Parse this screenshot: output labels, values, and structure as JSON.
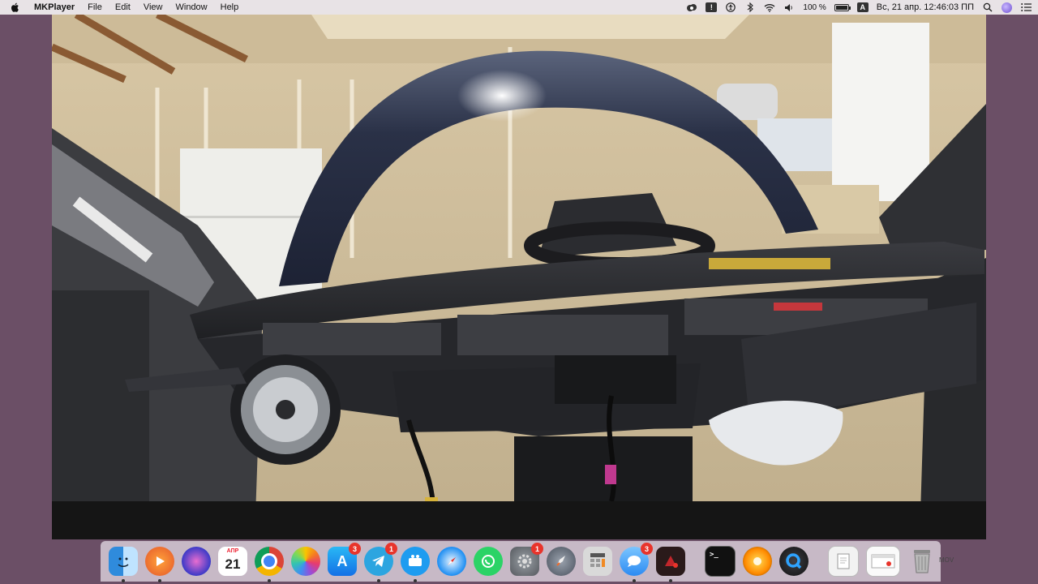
{
  "menubar": {
    "app_name": "MKPlayer",
    "menus": [
      "File",
      "Edit",
      "View",
      "Window",
      "Help"
    ],
    "battery_text": "100 %",
    "battery_level": 1.0,
    "input_source": "A",
    "datetime": "Вс, 21 апр.  12:46:03 ПП"
  },
  "dock": {
    "calendar_month": "АПР",
    "calendar_day": "21",
    "terminal_prompt": ">_",
    "badges": {
      "app_store": "3",
      "telegram": "1",
      "system_prefs": "1",
      "messages": "3"
    },
    "mov_label": "MOV"
  },
  "colors": {
    "menubar_bg": "#e8e3e6",
    "desktop_bg": "#6b4f66",
    "dock_bg": "#e1d7e1",
    "badge": "#e8342b"
  }
}
